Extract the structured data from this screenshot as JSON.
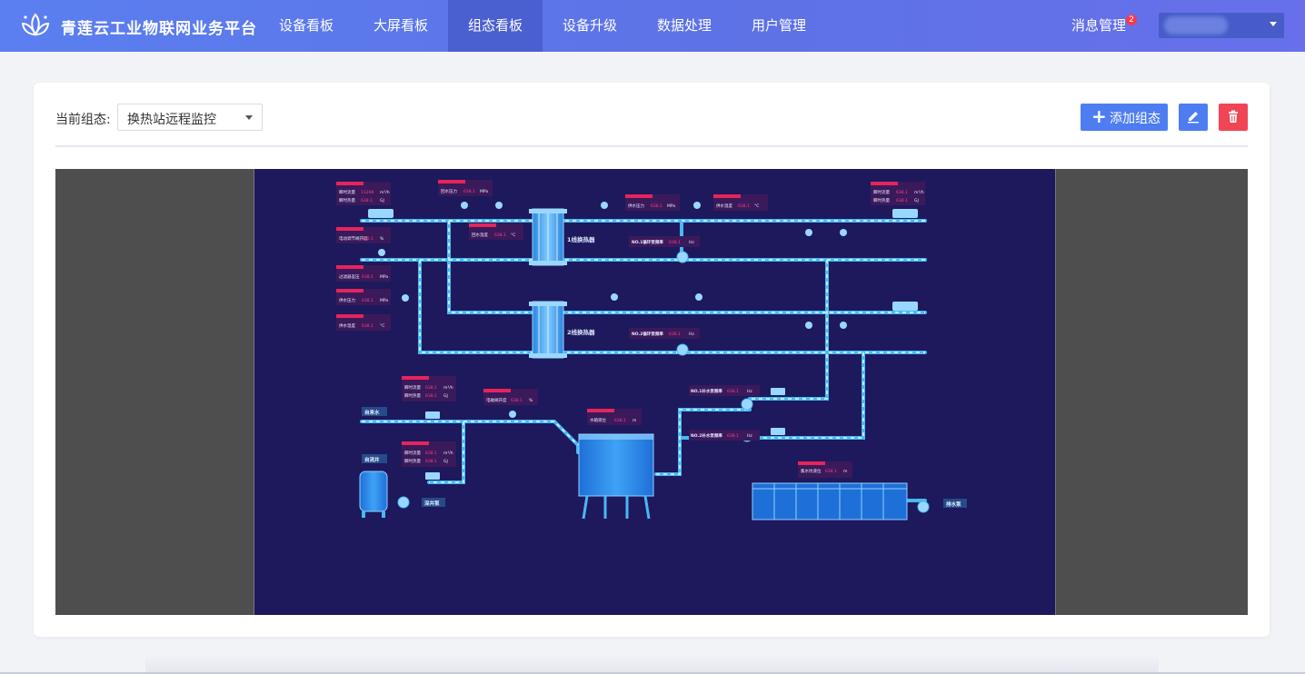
{
  "app": {
    "brand": "青莲云工业物联网业务平台",
    "nav": [
      {
        "label": "设备看板",
        "active": false
      },
      {
        "label": "大屏看板",
        "active": false
      },
      {
        "label": "组态看板",
        "active": true
      },
      {
        "label": "设备升级",
        "active": false
      },
      {
        "label": "数据处理",
        "active": false
      },
      {
        "label": "用户管理",
        "active": false
      }
    ],
    "messages": {
      "label": "消息管理",
      "count": "2"
    },
    "accent_color": "#5b7ff0",
    "danger_color": "#f04555"
  },
  "toolbar": {
    "current_label": "当前组态:",
    "current_value": "换热站远程监控",
    "add_label": "添加组态",
    "edit_icon": "pencil-icon",
    "delete_icon": "trash-icon"
  },
  "diagram": {
    "exchanger1": "1线换热器",
    "exchanger2": "2线换热器",
    "tap_water": "自来水",
    "deep_well": "自流井",
    "deep_pump": "深井泵",
    "drain_pump": "排水泵",
    "tank_level": "水箱液位",
    "pit_level": "集水坑液位",
    "pump1_freq": "NO.1循环泵频率",
    "pump2_freq": "NO.2循环泵频率",
    "makeup1_freq": "NO.1补水泵频率",
    "makeup2_freq": "NO.2补水泵频率",
    "unit_freq": "Hz",
    "valve_open": "电磁阀开度",
    "unit_pct": "%",
    "unit_m": "m",
    "flow_rate": "瞬时流量",
    "heat": "瞬时热量",
    "unit_flow": "m³/h",
    "unit_heat": "GJ",
    "supply_pressure": "供水压力",
    "supply_temp": "供水温度",
    "return_pressure": "回水压力",
    "return_temp": "回水温度",
    "filter_diff": "过滤器差压",
    "reg_valve": "电动调节阀开度",
    "unit_mpa": "MPa",
    "unit_c": "°C",
    "sample_value": "638.1",
    "flow_value": "11268"
  }
}
